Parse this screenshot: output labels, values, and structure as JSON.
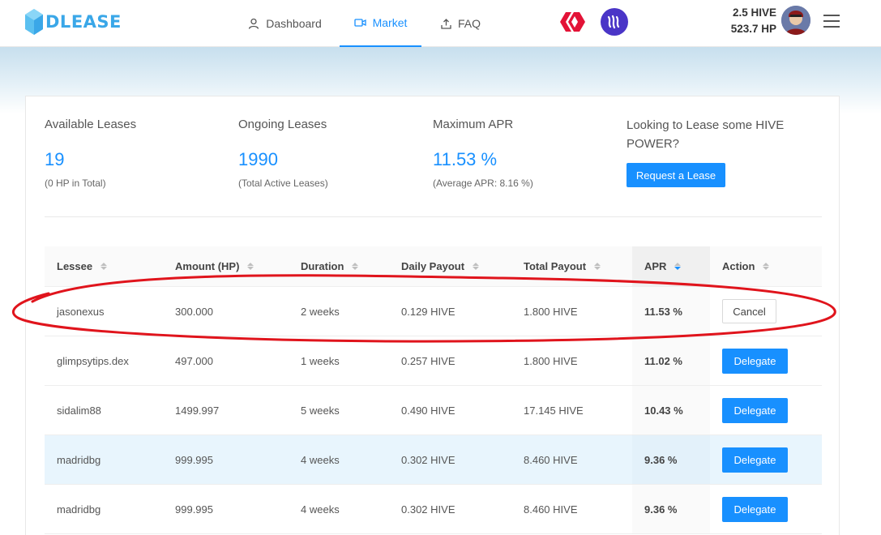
{
  "header": {
    "logo_text": "DLEASE",
    "nav": [
      {
        "label": "Dashboard"
      },
      {
        "label": "Market"
      },
      {
        "label": "FAQ"
      }
    ],
    "balances": {
      "hive": "2.5 HIVE",
      "hp": "523.7 HP"
    }
  },
  "stats": [
    {
      "title": "Available Leases",
      "value": "19",
      "sub": "(0 HP in Total)"
    },
    {
      "title": "Ongoing Leases",
      "value": "1990",
      "sub": "(Total Active Leases)"
    },
    {
      "title": "Maximum APR",
      "value": "11.53 %",
      "sub": "(Average APR: 8.16 %)"
    }
  ],
  "lease_cta": {
    "title": "Looking to Lease some HIVE POWER?",
    "button": "Request a Lease"
  },
  "table": {
    "columns": [
      "Lessee",
      "Amount (HP)",
      "Duration",
      "Daily Payout",
      "Total Payout",
      "APR",
      "Action"
    ],
    "rows": [
      {
        "lessee": "jasonexus",
        "amount": "300.000",
        "duration": "2 weeks",
        "daily": "0.129 HIVE",
        "total": "1.800 HIVE",
        "apr": "11.53 %",
        "action": "Cancel"
      },
      {
        "lessee": "glimpsytips.dex",
        "amount": "497.000",
        "duration": "1 weeks",
        "daily": "0.257 HIVE",
        "total": "1.800 HIVE",
        "apr": "11.02 %",
        "action": "Delegate"
      },
      {
        "lessee": "sidalim88",
        "amount": "1499.997",
        "duration": "5 weeks",
        "daily": "0.490 HIVE",
        "total": "17.145 HIVE",
        "apr": "10.43 %",
        "action": "Delegate"
      },
      {
        "lessee": "madridbg",
        "amount": "999.995",
        "duration": "4 weeks",
        "daily": "0.302 HIVE",
        "total": "8.460 HIVE",
        "apr": "9.36 %",
        "action": "Delegate"
      },
      {
        "lessee": "madridbg",
        "amount": "999.995",
        "duration": "4 weeks",
        "daily": "0.302 HIVE",
        "total": "8.460 HIVE",
        "apr": "9.36 %",
        "action": "Delegate"
      }
    ]
  },
  "colors": {
    "accent": "#1890ff",
    "hive_red": "#e31337",
    "steem_blue": "#4a35c7",
    "annotation": "#e0141c"
  }
}
